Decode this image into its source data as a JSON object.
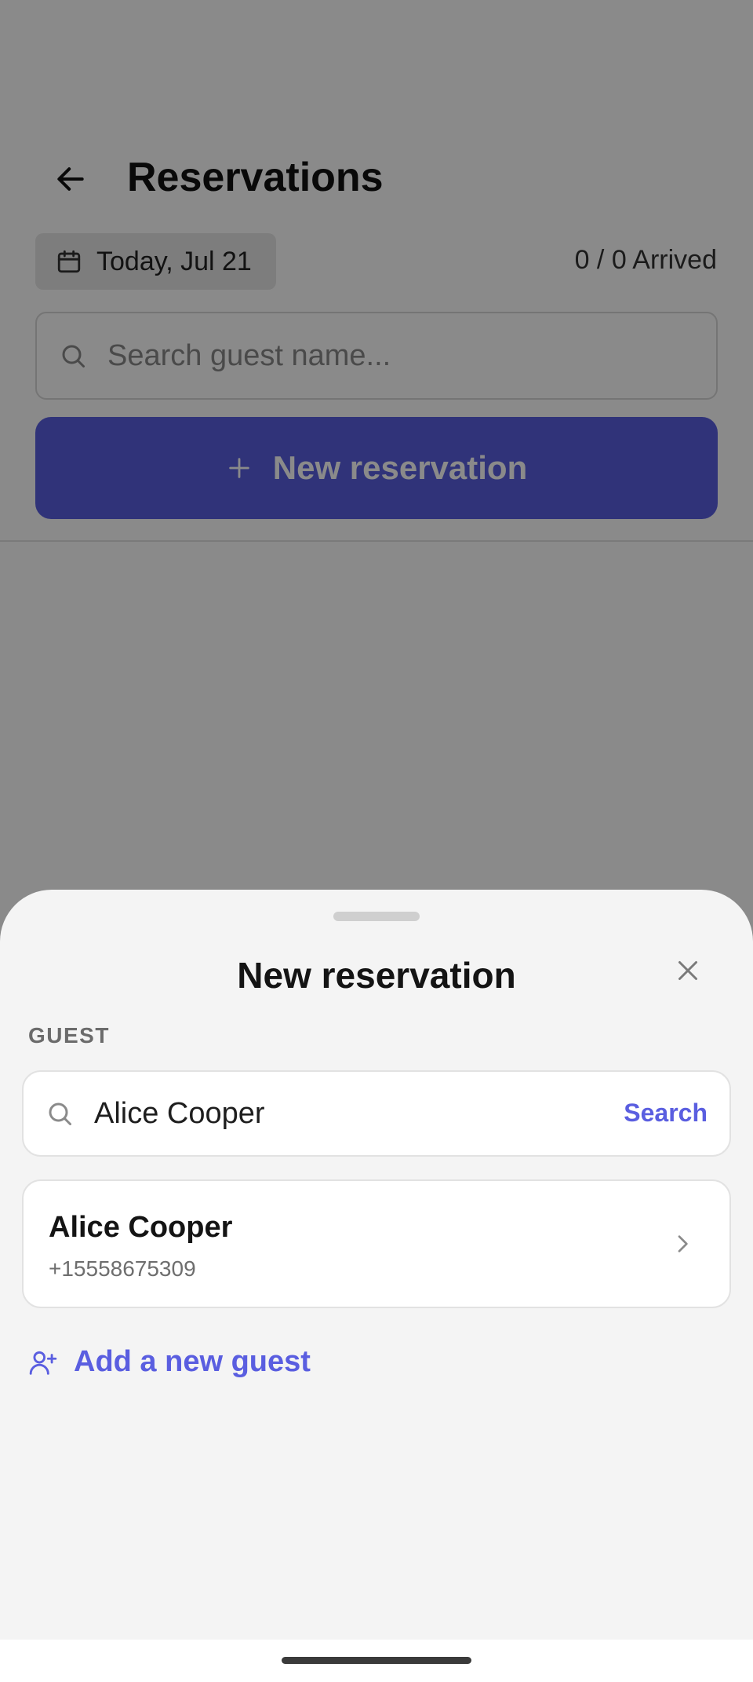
{
  "background": {
    "title": "Reservations",
    "date_chip": "Today, Jul 21",
    "arrived": "0 / 0 Arrived",
    "search_placeholder": "Search guest name...",
    "new_reservation_button": "New reservation"
  },
  "sheet": {
    "title": "New reservation",
    "section_label": "GUEST",
    "search": {
      "value": "Alice Cooper",
      "action": "Search"
    },
    "results": [
      {
        "name": "Alice Cooper",
        "phone": "+15558675309"
      }
    ],
    "add_guest": "Add a new guest"
  },
  "colors": {
    "accent": "#5a5ee0",
    "sheet_bg": "#f4f4f4",
    "scrim": "rgba(0,0,0,0.46)"
  },
  "icons": [
    "arrow-left-icon",
    "calendar-icon",
    "search-icon",
    "plus-icon",
    "close-icon",
    "chevron-right-icon",
    "user-plus-icon"
  ]
}
